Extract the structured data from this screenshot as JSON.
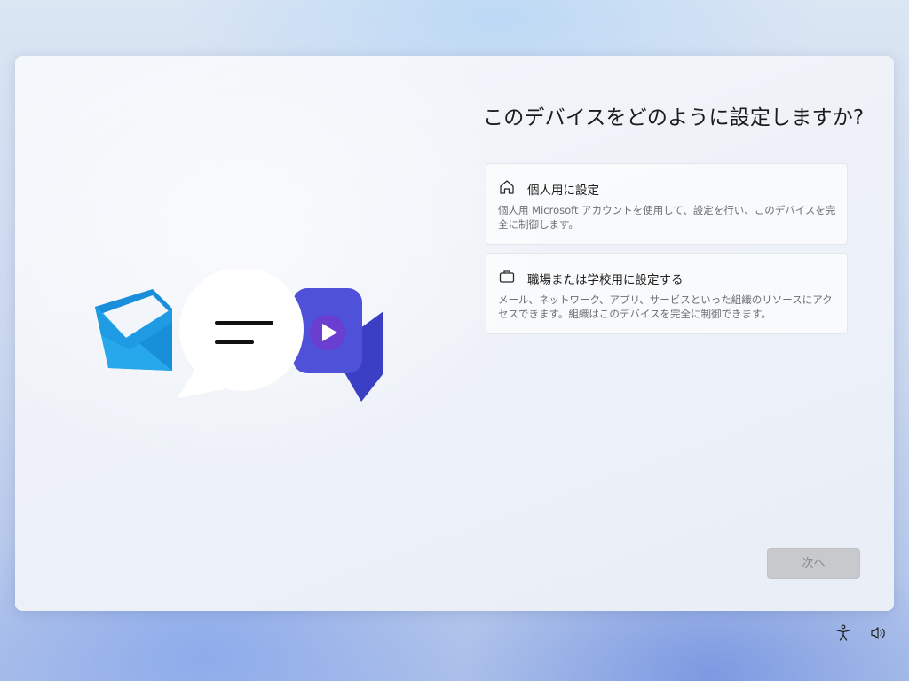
{
  "setup": {
    "title": "このデバイスをどのように設定しますか?",
    "options": [
      {
        "icon": "home-icon",
        "title": "個人用に設定",
        "description": "個人用 Microsoft アカウントを使用して、設定を行い、このデバイスを完全に制御します。"
      },
      {
        "icon": "briefcase-icon",
        "title": "職場または学校用に設定する",
        "description": "メール、ネットワーク、アプリ、サービスといった組織のリソースにアクセスできます。組織はこのデバイスを完全に制御できます。"
      }
    ],
    "next_label": "次へ"
  },
  "tray": {
    "icons": [
      "accessibility-icon",
      "volume-icon"
    ]
  },
  "colors": {
    "mail_blue": "#1e9be3",
    "video_purple": "#4f52d8",
    "button_disabled": "#c7c9cd"
  }
}
